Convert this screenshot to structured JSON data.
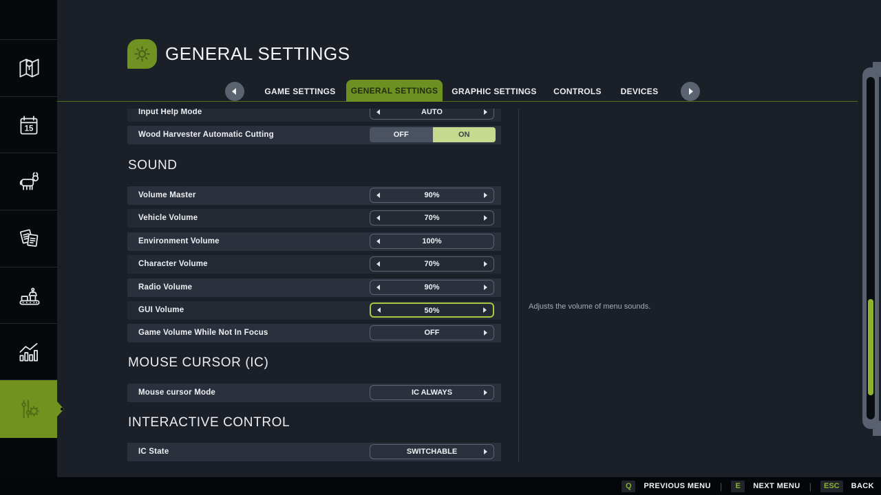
{
  "header": {
    "title": "GENERAL SETTINGS"
  },
  "tabs": {
    "items": [
      {
        "label": "GAME SETTINGS",
        "active": false
      },
      {
        "label": "GENERAL SETTINGS",
        "active": true
      },
      {
        "label": "GRAPHIC SETTINGS",
        "active": false
      },
      {
        "label": "CONTROLS",
        "active": false
      },
      {
        "label": "DEVICES",
        "active": false
      }
    ]
  },
  "sidebar": {
    "items": [
      "map",
      "calendar",
      "animals",
      "contracts",
      "production",
      "statistics",
      "settings"
    ],
    "active_item": "settings",
    "calendar_day": "15"
  },
  "list": {
    "row_input_help": {
      "label": "Input Help Mode",
      "value": "AUTO"
    },
    "row_wood": {
      "label": "Wood Harvester Automatic Cutting",
      "off": "OFF",
      "on": "ON",
      "state": "ON"
    },
    "section_sound": "SOUND",
    "row_volume_master": {
      "label": "Volume Master",
      "value": "90%"
    },
    "row_vehicle_volume": {
      "label": "Vehicle Volume",
      "value": "70%"
    },
    "row_environment_volume": {
      "label": "Environment Volume",
      "value": "100%"
    },
    "row_character_volume": {
      "label": "Character Volume",
      "value": "70%"
    },
    "row_radio_volume": {
      "label": "Radio Volume",
      "value": "90%"
    },
    "row_gui_volume": {
      "label": "GUI Volume",
      "value": "50%",
      "focused": true
    },
    "row_game_volume_focus": {
      "label": "Game Volume While Not In Focus",
      "value": "OFF"
    },
    "section_mouse": "MOUSE CURSOR (IC)",
    "row_mouse_cursor_mode": {
      "label": "Mouse cursor Mode",
      "value": "IC ALWAYS"
    },
    "section_ic": "INTERACTIVE CONTROL",
    "row_ic_state": {
      "label": "IC State",
      "value": "SWITCHABLE"
    }
  },
  "description": "Adjusts the volume of menu sounds.",
  "bottom_bar": {
    "separator": "|",
    "items": [
      {
        "key": "Q",
        "label": "PREVIOUS MENU"
      },
      {
        "key": "E",
        "label": "NEXT MENU"
      },
      {
        "key": "ESC",
        "label": "BACK"
      }
    ]
  },
  "colors": {
    "accent_green": "#71921f",
    "active_tab_green": "#6d9023",
    "toggle_on": "#c5da8e",
    "focus_border_green": "#a9c93f",
    "scroll_thumb_green": "#8db32f",
    "key_hint_green": "#8fae33",
    "row_light": "#2b313c",
    "row_dark": "#242a34",
    "background": "#1a1f28"
  }
}
